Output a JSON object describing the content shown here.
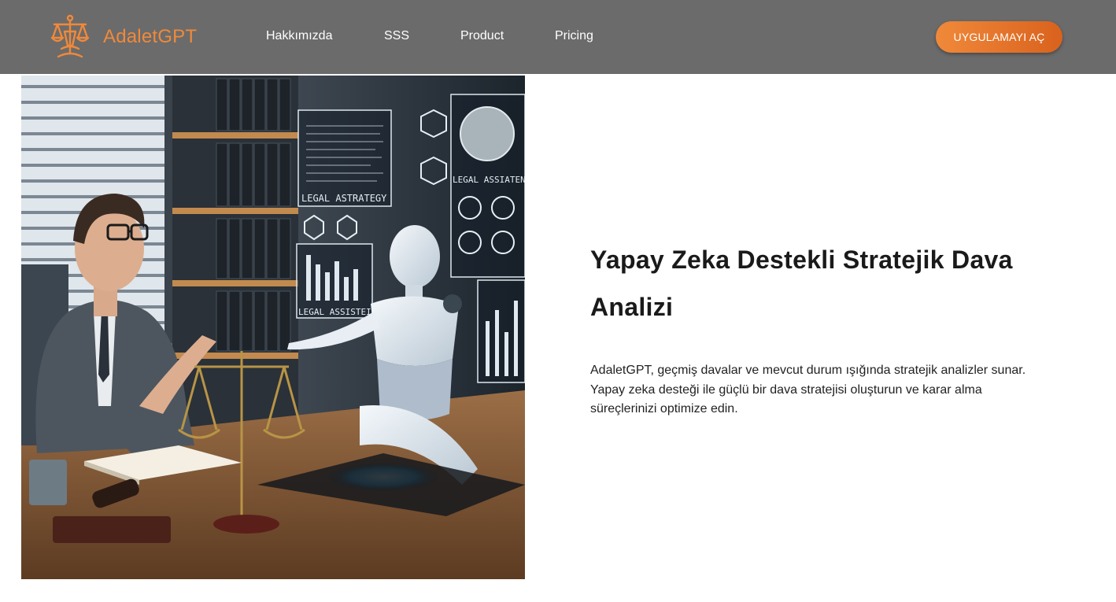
{
  "brand": {
    "name": "AdaletGPT",
    "logo_icon": "scales-of-justice-icon",
    "color": "#f0893a"
  },
  "nav": {
    "items": [
      {
        "label": "Hakkımızda"
      },
      {
        "label": "SSS"
      },
      {
        "label": "Product"
      },
      {
        "label": "Pricing"
      }
    ],
    "background": "#6b6b6b"
  },
  "cta": {
    "label": "UYGULAMAYI AÇ",
    "gradient": [
      "#f0893a",
      "#d9621d"
    ]
  },
  "hero": {
    "image_labels": [
      "LEGAL ASTRATEGY",
      "LEGAL ASSIATENC",
      "LEGAL ASSISTEIGTE"
    ],
    "headline": "Yapay Zeka Destekli Stratejik Dava Analizi",
    "description": "AdaletGPT, geçmiş davalar ve mevcut durum ışığında stratejik analizler sunar. Yapay zeka desteği ile güçlü bir dava stratejisi oluşturun ve karar alma süreçlerinizi optimize edin."
  }
}
